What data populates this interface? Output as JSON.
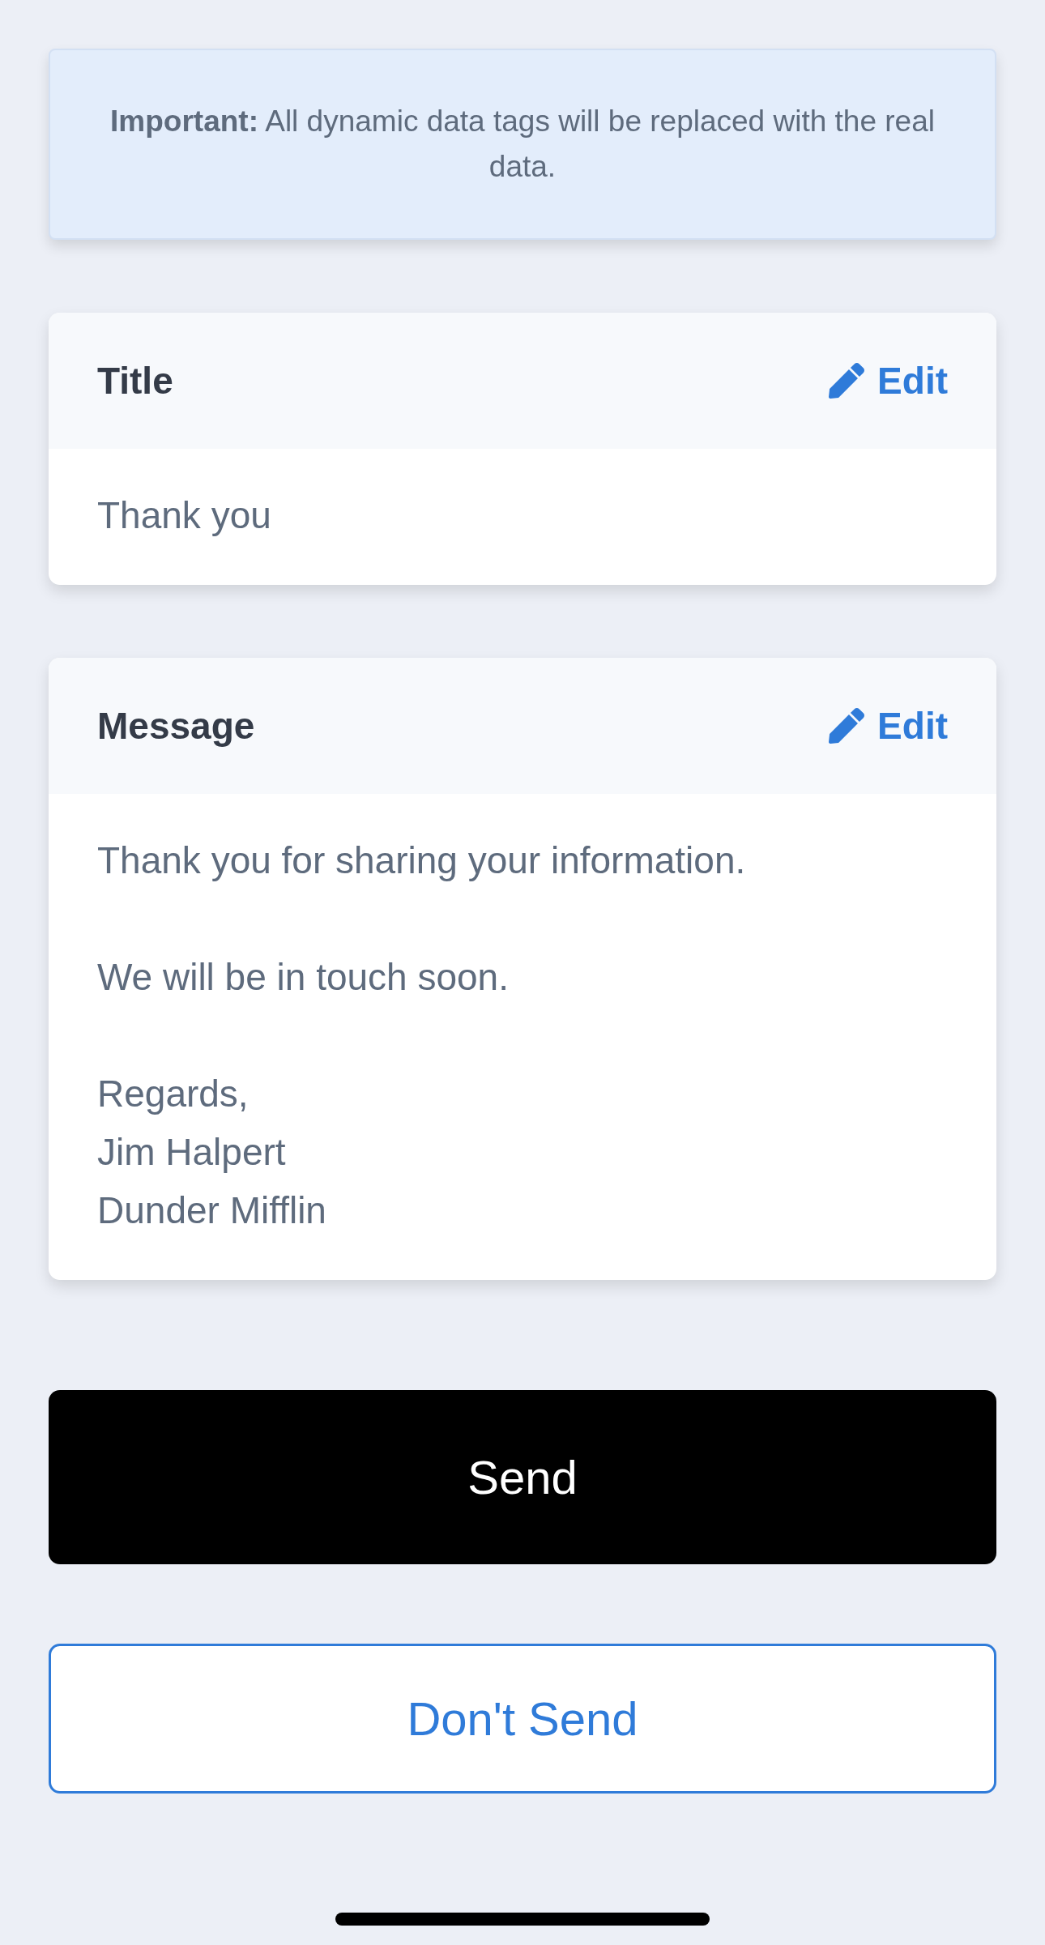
{
  "notice": {
    "text": "**Important:** All dynamic data tags will be replaced with the real data."
  },
  "cards": [
    {
      "title": "Title",
      "edit_label": "Edit",
      "paragraphs": [
        "Thank you"
      ]
    },
    {
      "title": "Message",
      "edit_label": "Edit",
      "paragraphs": [
        "Thank you for sharing your information.",
        "We will be in touch soon.",
        "Regards,\nJim Halpert\nDunder Mifflin"
      ]
    }
  ],
  "send_button": "Send",
  "dont_send_button": "Don't Send"
}
